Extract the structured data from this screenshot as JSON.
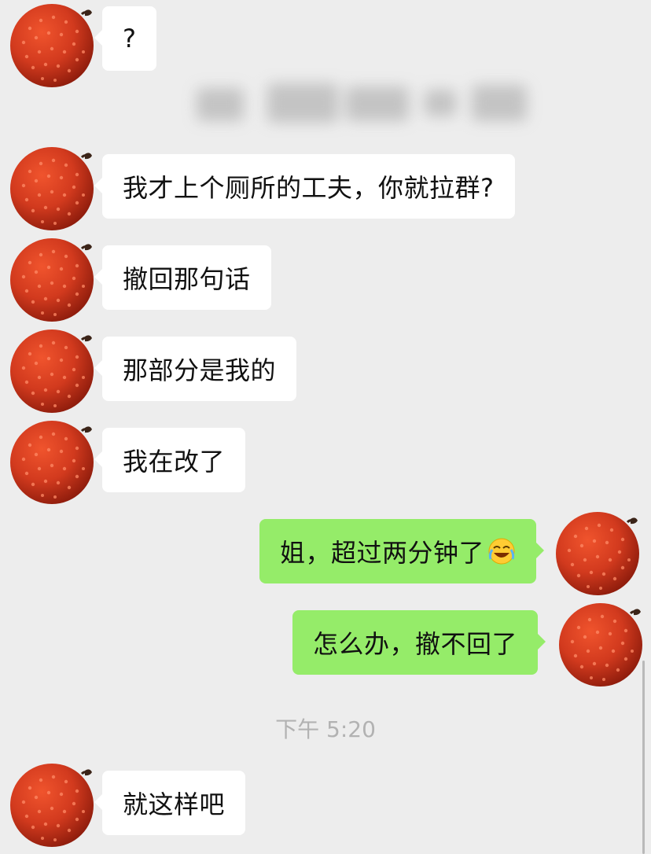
{
  "conversation": {
    "messages": [
      {
        "side": "left",
        "text": "?"
      },
      {
        "side": "left",
        "text": "我才上个厕所的工夫，你就拉群?"
      },
      {
        "side": "left",
        "text": "撤回那句话"
      },
      {
        "side": "left",
        "text": "那部分是我的"
      },
      {
        "side": "left",
        "text": "我在改了"
      },
      {
        "side": "right",
        "text": "姐，超过两分钟了",
        "emoji": "rolling-on-floor-laughing-icon"
      },
      {
        "side": "right",
        "text": "怎么办，撤不回了"
      },
      {
        "side": "left",
        "text": "就这样吧"
      }
    ],
    "timestamp": "下午 5:20"
  },
  "avatar": {
    "icon": "lychee-avatar-icon",
    "color": "#D23A1E",
    "stem_color": "#3B2418"
  },
  "colors": {
    "background": "#EDEDED",
    "bubble_left": "#FFFFFF",
    "bubble_right": "#95EC69",
    "timestamp": "#B2B2B2"
  }
}
